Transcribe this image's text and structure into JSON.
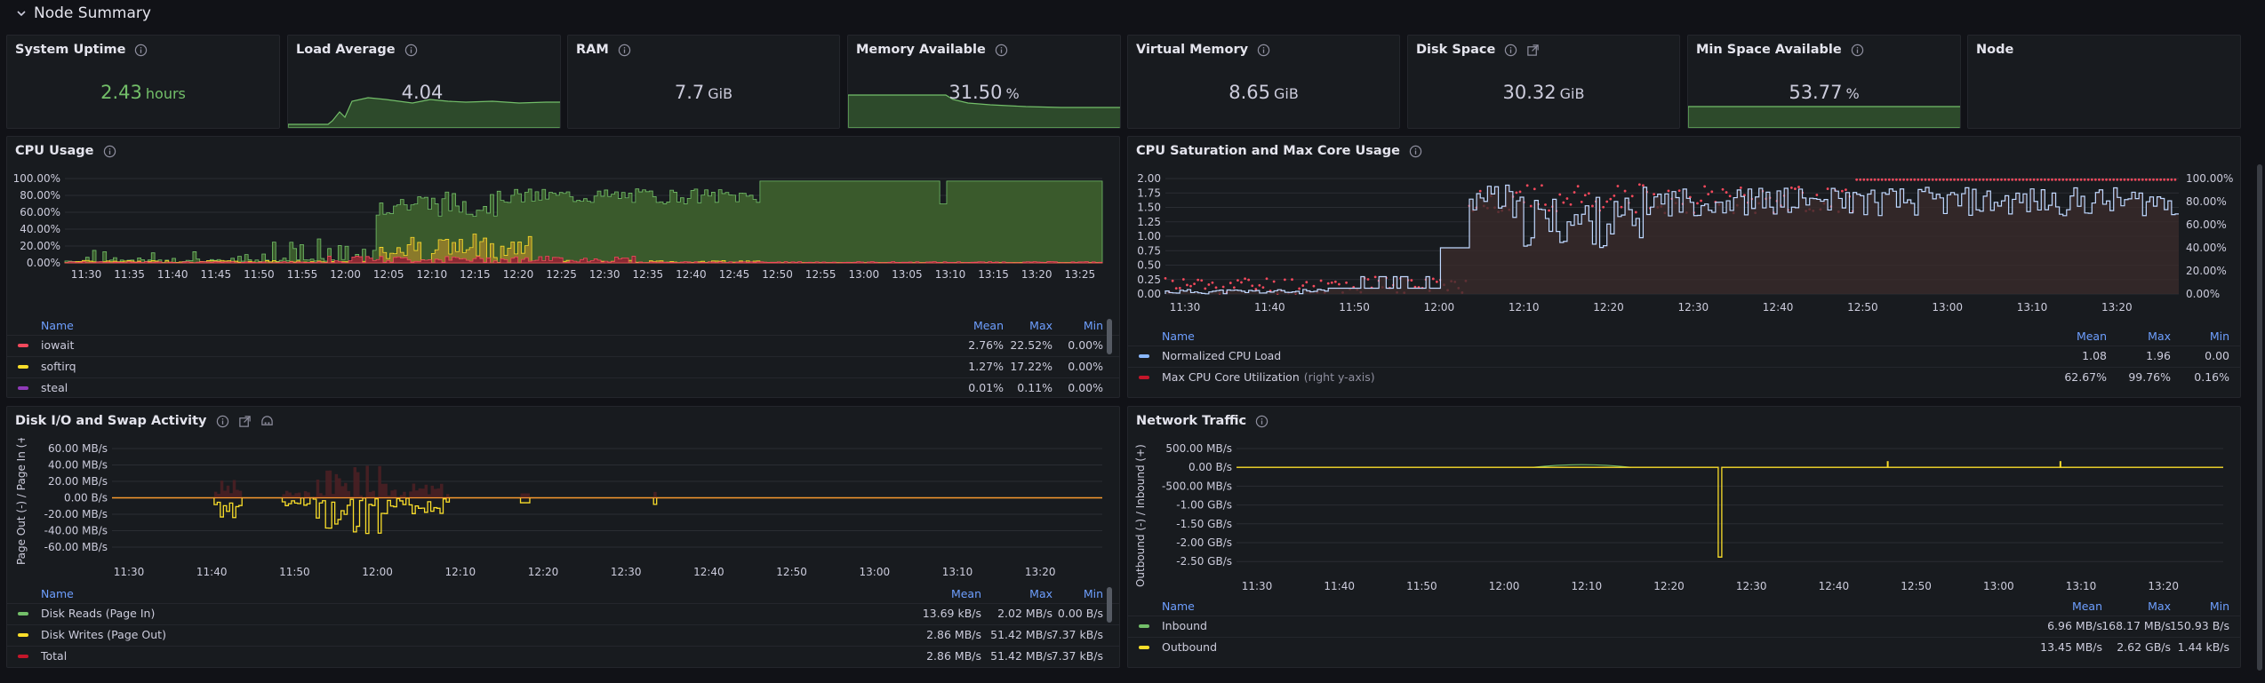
{
  "row": {
    "title": "Node Summary"
  },
  "stats": [
    {
      "title": "System Uptime",
      "value": "2.43",
      "unit": "hours"
    },
    {
      "title": "Load Average",
      "value": "4.04",
      "unit": ""
    },
    {
      "title": "RAM",
      "value": "7.7",
      "unit": "GiB"
    },
    {
      "title": "Memory Available",
      "value": "31.50",
      "unit": "%"
    },
    {
      "title": "Virtual Memory",
      "value": "8.65",
      "unit": "GiB"
    },
    {
      "title": "Disk Space",
      "value": "30.32",
      "unit": "GiB"
    },
    {
      "title": "Min Space Available",
      "value": "53.77",
      "unit": "%"
    },
    {
      "title": "Node",
      "value": "",
      "unit": ""
    }
  ],
  "cpu_usage": {
    "title": "CPU Usage",
    "y_ticks": [
      "100.00%",
      "80.00%",
      "60.00%",
      "40.00%",
      "20.00%",
      "0.00%"
    ],
    "x_ticks": [
      "11:30",
      "11:35",
      "11:40",
      "11:45",
      "11:50",
      "11:55",
      "12:00",
      "12:05",
      "12:10",
      "12:15",
      "12:20",
      "12:25",
      "12:30",
      "12:35",
      "12:40",
      "12:45",
      "12:50",
      "12:55",
      "13:00",
      "13:05",
      "13:10",
      "13:15",
      "13:20",
      "13:25"
    ],
    "legend_headers": {
      "name": "Name",
      "mean": "Mean",
      "max": "Max",
      "min": "Min"
    },
    "legend": [
      {
        "name": "iowait",
        "mean": "2.76%",
        "max": "22.52%",
        "min": "0.00%",
        "color": "#f2495c"
      },
      {
        "name": "softirq",
        "mean": "1.27%",
        "max": "17.22%",
        "min": "0.00%",
        "color": "#fade2a"
      },
      {
        "name": "steal",
        "mean": "0.01%",
        "max": "0.11%",
        "min": "0.00%",
        "color": "#8f3bb8"
      }
    ]
  },
  "cpu_sat": {
    "title": "CPU Saturation and Max Core Usage",
    "y_ticks_left": [
      "2.00",
      "1.75",
      "1.50",
      "1.25",
      "1.00",
      "0.75",
      "0.50",
      "0.25",
      "0.00"
    ],
    "y_ticks_right": [
      "100.00%",
      "80.00%",
      "60.00%",
      "40.00%",
      "20.00%",
      "0.00%"
    ],
    "x_ticks": [
      "11:30",
      "11:40",
      "11:50",
      "12:00",
      "12:10",
      "12:20",
      "12:30",
      "12:40",
      "12:50",
      "13:00",
      "13:10",
      "13:20"
    ],
    "legend_headers": {
      "name": "Name",
      "mean": "Mean",
      "max": "Max",
      "min": "Min"
    },
    "legend": [
      {
        "name": "Normalized CPU Load",
        "sub": "",
        "mean": "1.08",
        "max": "1.96",
        "min": "0.00",
        "color": "#8ab8ff"
      },
      {
        "name": "Max CPU Core Utilization",
        "sub": "(right y-axis)",
        "mean": "62.67%",
        "max": "99.76%",
        "min": "0.16%",
        "color": "#c4162a"
      }
    ]
  },
  "disk_io": {
    "title": "Disk I/O and Swap Activity",
    "y_label": "Page Out (-) / Page In (+)",
    "y_ticks": [
      "60.00 MB/s",
      "40.00 MB/s",
      "20.00 MB/s",
      "0.00 B/s",
      "-20.00 MB/s",
      "-40.00 MB/s",
      "-60.00 MB/s"
    ],
    "x_ticks": [
      "11:30",
      "11:40",
      "11:50",
      "12:00",
      "12:10",
      "12:20",
      "12:30",
      "12:40",
      "12:50",
      "13:00",
      "13:10",
      "13:20"
    ],
    "legend_headers": {
      "name": "Name",
      "mean": "Mean",
      "max": "Max",
      "min": "Min"
    },
    "legend": [
      {
        "name": "Disk Reads (Page In)",
        "mean": "13.69 kB/s",
        "max": "2.02 MB/s",
        "min": "0.00 B/s",
        "color": "#73bf69"
      },
      {
        "name": "Disk Writes (Page Out)",
        "mean": "2.86 MB/s",
        "max": "51.42 MB/s",
        "min": "7.37 kB/s",
        "color": "#fade2a"
      },
      {
        "name": "Total",
        "mean": "2.86 MB/s",
        "max": "51.42 MB/s",
        "min": "7.37 kB/s",
        "color": "#c4162a"
      }
    ]
  },
  "network": {
    "title": "Network Traffic",
    "y_label": "Outbound (-) / Inbound (+)",
    "y_ticks": [
      "500.00 MB/s",
      "0.00 B/s",
      "-500.00 MB/s",
      "-1.00 GB/s",
      "-1.50 GB/s",
      "-2.00 GB/s",
      "-2.50 GB/s"
    ],
    "x_ticks": [
      "11:30",
      "11:40",
      "11:50",
      "12:00",
      "12:10",
      "12:20",
      "12:30",
      "12:40",
      "12:50",
      "13:00",
      "13:10",
      "13:20"
    ],
    "legend_headers": {
      "name": "Name",
      "mean": "Mean",
      "max": "Max",
      "min": "Min"
    },
    "legend": [
      {
        "name": "Inbound",
        "mean": "6.96 MB/s",
        "max": "168.17 MB/s",
        "min": "150.93 B/s",
        "color": "#73bf69"
      },
      {
        "name": "Outbound",
        "mean": "13.45 MB/s",
        "max": "2.62 GB/s",
        "min": "1.44 kB/s",
        "color": "#fade2a"
      }
    ]
  }
}
